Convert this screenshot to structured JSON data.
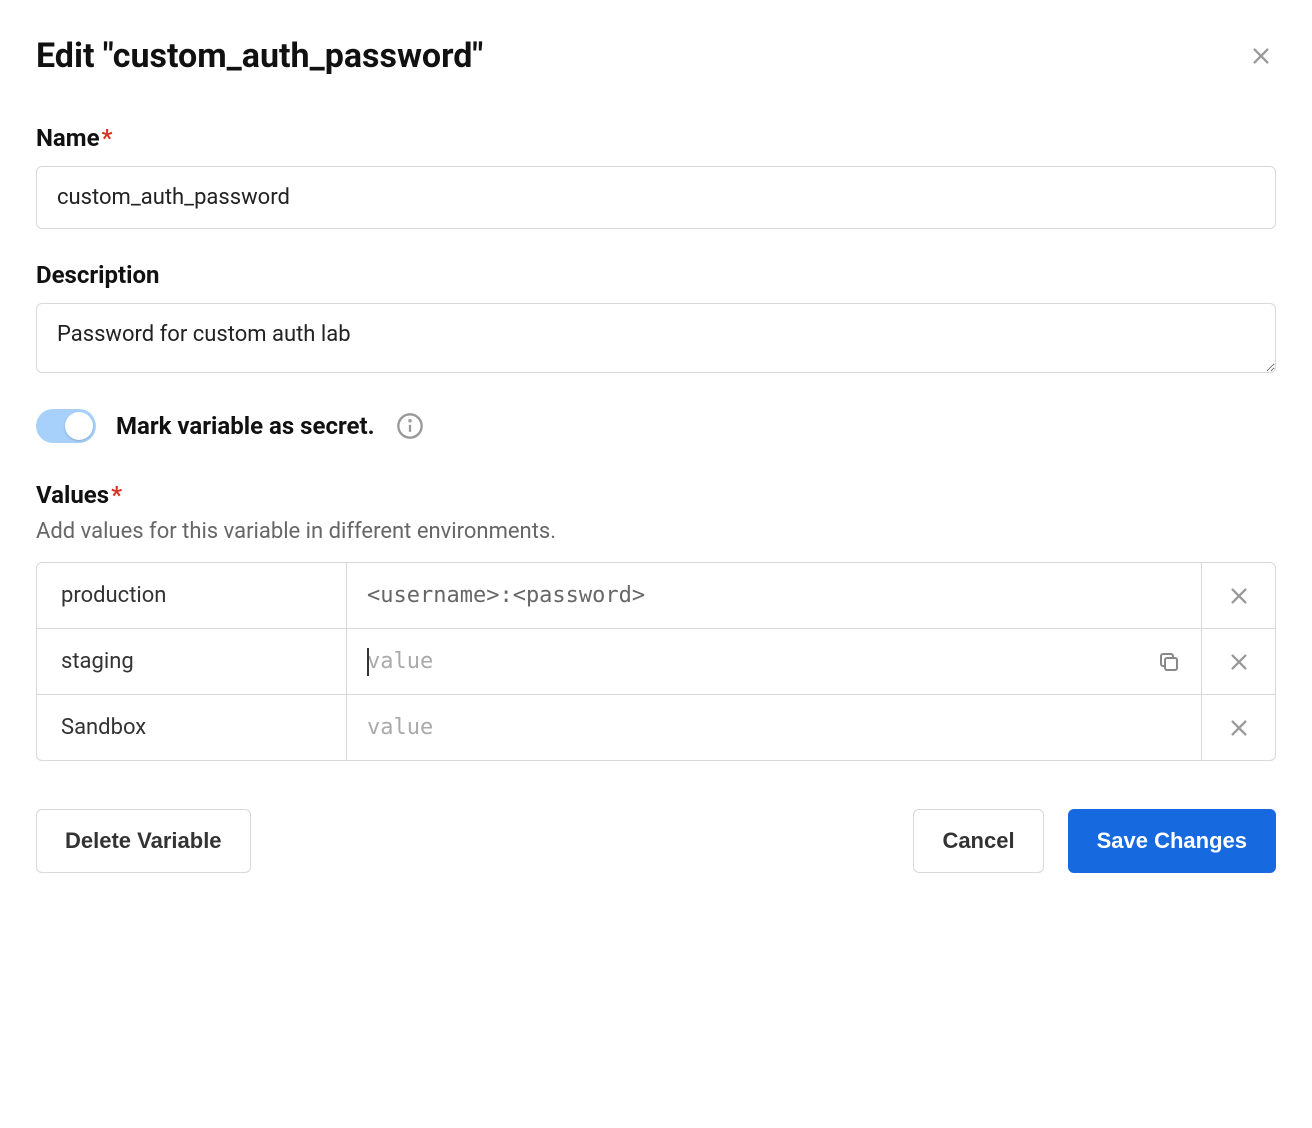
{
  "title": "Edit \"custom_auth_password\"",
  "fields": {
    "name": {
      "label": "Name",
      "required": true,
      "value": "custom_auth_password"
    },
    "description": {
      "label": "Description",
      "value": "Password for custom auth lab"
    },
    "secret_toggle": {
      "label": "Mark variable as secret.",
      "on": true
    },
    "values": {
      "label": "Values",
      "required": true,
      "hint": "Add values for this variable in different environments.",
      "placeholder": "value",
      "rows": [
        {
          "env": "production",
          "value": "<username>:<password>",
          "focused": false,
          "show_copy": false
        },
        {
          "env": "staging",
          "value": "",
          "focused": true,
          "show_copy": true
        },
        {
          "env": "Sandbox",
          "value": "",
          "focused": false,
          "show_copy": false
        }
      ]
    }
  },
  "buttons": {
    "delete": "Delete Variable",
    "cancel": "Cancel",
    "save": "Save Changes"
  }
}
